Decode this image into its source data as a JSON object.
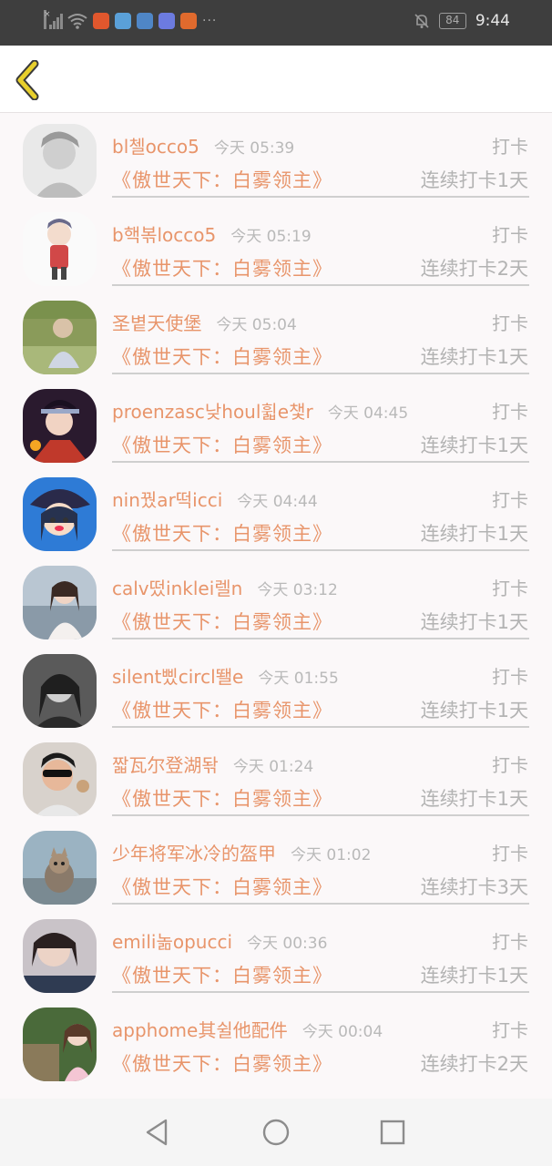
{
  "status_bar": {
    "time": "9:44",
    "battery": "84"
  },
  "header": {
    "back_icon": "chevron-left-icon"
  },
  "rows": [
    {
      "name": "bl첼occo5",
      "time": "今天 05:39",
      "tag": "打卡",
      "book": "《傲世天下：白雾领主》",
      "streak": "连续打卡1天"
    },
    {
      "name": "b핵볶locco5",
      "time": "今天 05:19",
      "tag": "打卡",
      "book": "《傲世天下：白雾领主》",
      "streak": "连续打卡2天"
    },
    {
      "name": "圣볕天使堡",
      "time": "今天 05:04",
      "tag": "打卡",
      "book": "《傲世天下：白雾领主》",
      "streak": "连续打卡1天"
    },
    {
      "name": "proenzasc낮houl휣e챛r",
      "time": "今天 04:45",
      "tag": "打卡",
      "book": "《傲世天下：白雾领主》",
      "streak": "连续打卡1天"
    },
    {
      "name": "nin꿨ar떡icci",
      "time": "今天 04:44",
      "tag": "打卡",
      "book": "《傲世天下：白雾领主》",
      "streak": "连续打卡1天"
    },
    {
      "name": "calv떴inklei렐n",
      "time": "今天 03:12",
      "tag": "打卡",
      "book": "《傲世天下：白雾领主》",
      "streak": "连续打卡1天"
    },
    {
      "name": "silent삤circl뙐e",
      "time": "今天 01:55",
      "tag": "打卡",
      "book": "《傲世天下：白雾领主》",
      "streak": "连续打卡1天"
    },
    {
      "name": "짧瓦尔登湖돢",
      "time": "今天 01:24",
      "tag": "打卡",
      "book": "《傲世天下：白雾领主》",
      "streak": "连续打卡1天"
    },
    {
      "name": "少年将军冰冷的盔甲",
      "time": "今天 01:02",
      "tag": "打卡",
      "book": "《傲世天下：白雾领主》",
      "streak": "连续打卡3天"
    },
    {
      "name": "emili놂opucci",
      "time": "今天 00:36",
      "tag": "打卡",
      "book": "《傲世天下：白雾领主》",
      "streak": "连续打卡1天"
    },
    {
      "name": "apphome其쉴他配件",
      "time": "今天 00:04",
      "tag": "打卡",
      "book": "《傲世天下：白雾领主》",
      "streak": "连续打卡2天"
    }
  ],
  "colors": {
    "accent": "#e8956b",
    "muted": "#b3b3b3",
    "back_icon": "#e7cf2c"
  },
  "navbar": {
    "back": "triangle-back-icon",
    "home": "circle-home-icon",
    "recents": "square-recents-icon"
  }
}
